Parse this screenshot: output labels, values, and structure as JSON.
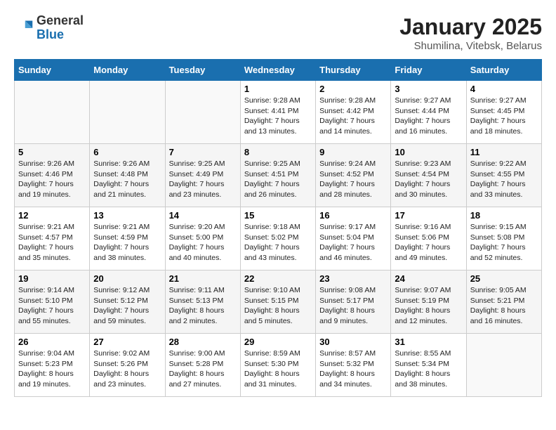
{
  "header": {
    "logo_general": "General",
    "logo_blue": "Blue",
    "month_year": "January 2025",
    "location": "Shumilina, Vitebsk, Belarus"
  },
  "days_of_week": [
    "Sunday",
    "Monday",
    "Tuesday",
    "Wednesday",
    "Thursday",
    "Friday",
    "Saturday"
  ],
  "weeks": [
    [
      {
        "day": "",
        "info": ""
      },
      {
        "day": "",
        "info": ""
      },
      {
        "day": "",
        "info": ""
      },
      {
        "day": "1",
        "info": "Sunrise: 9:28 AM\nSunset: 4:41 PM\nDaylight: 7 hours\nand 13 minutes."
      },
      {
        "day": "2",
        "info": "Sunrise: 9:28 AM\nSunset: 4:42 PM\nDaylight: 7 hours\nand 14 minutes."
      },
      {
        "day": "3",
        "info": "Sunrise: 9:27 AM\nSunset: 4:44 PM\nDaylight: 7 hours\nand 16 minutes."
      },
      {
        "day": "4",
        "info": "Sunrise: 9:27 AM\nSunset: 4:45 PM\nDaylight: 7 hours\nand 18 minutes."
      }
    ],
    [
      {
        "day": "5",
        "info": "Sunrise: 9:26 AM\nSunset: 4:46 PM\nDaylight: 7 hours\nand 19 minutes."
      },
      {
        "day": "6",
        "info": "Sunrise: 9:26 AM\nSunset: 4:48 PM\nDaylight: 7 hours\nand 21 minutes."
      },
      {
        "day": "7",
        "info": "Sunrise: 9:25 AM\nSunset: 4:49 PM\nDaylight: 7 hours\nand 23 minutes."
      },
      {
        "day": "8",
        "info": "Sunrise: 9:25 AM\nSunset: 4:51 PM\nDaylight: 7 hours\nand 26 minutes."
      },
      {
        "day": "9",
        "info": "Sunrise: 9:24 AM\nSunset: 4:52 PM\nDaylight: 7 hours\nand 28 minutes."
      },
      {
        "day": "10",
        "info": "Sunrise: 9:23 AM\nSunset: 4:54 PM\nDaylight: 7 hours\nand 30 minutes."
      },
      {
        "day": "11",
        "info": "Sunrise: 9:22 AM\nSunset: 4:55 PM\nDaylight: 7 hours\nand 33 minutes."
      }
    ],
    [
      {
        "day": "12",
        "info": "Sunrise: 9:21 AM\nSunset: 4:57 PM\nDaylight: 7 hours\nand 35 minutes."
      },
      {
        "day": "13",
        "info": "Sunrise: 9:21 AM\nSunset: 4:59 PM\nDaylight: 7 hours\nand 38 minutes."
      },
      {
        "day": "14",
        "info": "Sunrise: 9:20 AM\nSunset: 5:00 PM\nDaylight: 7 hours\nand 40 minutes."
      },
      {
        "day": "15",
        "info": "Sunrise: 9:18 AM\nSunset: 5:02 PM\nDaylight: 7 hours\nand 43 minutes."
      },
      {
        "day": "16",
        "info": "Sunrise: 9:17 AM\nSunset: 5:04 PM\nDaylight: 7 hours\nand 46 minutes."
      },
      {
        "day": "17",
        "info": "Sunrise: 9:16 AM\nSunset: 5:06 PM\nDaylight: 7 hours\nand 49 minutes."
      },
      {
        "day": "18",
        "info": "Sunrise: 9:15 AM\nSunset: 5:08 PM\nDaylight: 7 hours\nand 52 minutes."
      }
    ],
    [
      {
        "day": "19",
        "info": "Sunrise: 9:14 AM\nSunset: 5:10 PM\nDaylight: 7 hours\nand 55 minutes."
      },
      {
        "day": "20",
        "info": "Sunrise: 9:12 AM\nSunset: 5:12 PM\nDaylight: 7 hours\nand 59 minutes."
      },
      {
        "day": "21",
        "info": "Sunrise: 9:11 AM\nSunset: 5:13 PM\nDaylight: 8 hours\nand 2 minutes."
      },
      {
        "day": "22",
        "info": "Sunrise: 9:10 AM\nSunset: 5:15 PM\nDaylight: 8 hours\nand 5 minutes."
      },
      {
        "day": "23",
        "info": "Sunrise: 9:08 AM\nSunset: 5:17 PM\nDaylight: 8 hours\nand 9 minutes."
      },
      {
        "day": "24",
        "info": "Sunrise: 9:07 AM\nSunset: 5:19 PM\nDaylight: 8 hours\nand 12 minutes."
      },
      {
        "day": "25",
        "info": "Sunrise: 9:05 AM\nSunset: 5:21 PM\nDaylight: 8 hours\nand 16 minutes."
      }
    ],
    [
      {
        "day": "26",
        "info": "Sunrise: 9:04 AM\nSunset: 5:23 PM\nDaylight: 8 hours\nand 19 minutes."
      },
      {
        "day": "27",
        "info": "Sunrise: 9:02 AM\nSunset: 5:26 PM\nDaylight: 8 hours\nand 23 minutes."
      },
      {
        "day": "28",
        "info": "Sunrise: 9:00 AM\nSunset: 5:28 PM\nDaylight: 8 hours\nand 27 minutes."
      },
      {
        "day": "29",
        "info": "Sunrise: 8:59 AM\nSunset: 5:30 PM\nDaylight: 8 hours\nand 31 minutes."
      },
      {
        "day": "30",
        "info": "Sunrise: 8:57 AM\nSunset: 5:32 PM\nDaylight: 8 hours\nand 34 minutes."
      },
      {
        "day": "31",
        "info": "Sunrise: 8:55 AM\nSunset: 5:34 PM\nDaylight: 8 hours\nand 38 minutes."
      },
      {
        "day": "",
        "info": ""
      }
    ]
  ]
}
